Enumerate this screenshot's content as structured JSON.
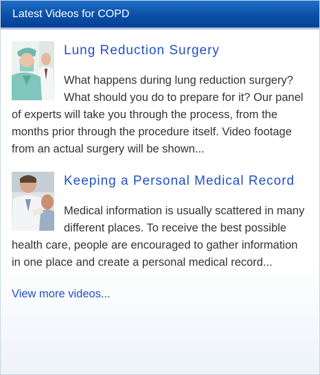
{
  "widget": {
    "title": "Latest Videos for COPD",
    "videos": [
      {
        "title": "Lung Reduction Surgery",
        "description": "What happens during lung reduction surgery? What should you do to prepare for it? Our panel of experts will take you through the process, from the months prior through the procedure itself. Video footage from an actual surgery will be shown..."
      },
      {
        "title": "Keeping a Personal Medical Record",
        "description": "Medical information is usually scattered in many different places. To receive the best possible health care, people are encouraged to gather information in one place and create a personal medical record..."
      }
    ],
    "more_link": "View more videos..."
  }
}
